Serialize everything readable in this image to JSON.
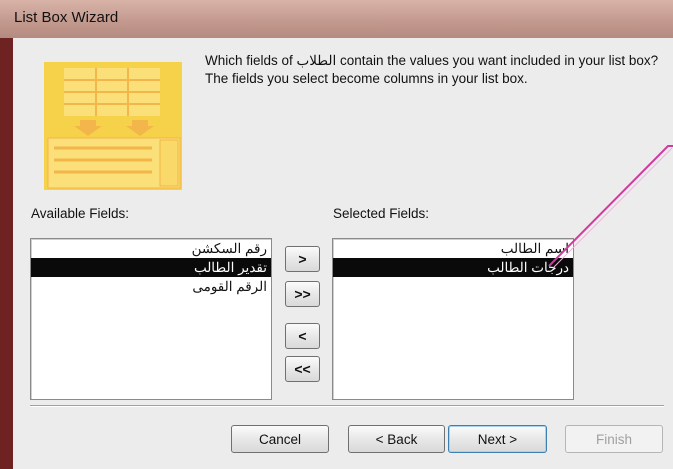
{
  "window": {
    "title": "List Box Wizard"
  },
  "instruction": "Which fields of الطلاب contain the values you want included in your list box? The fields you select become columns in your list box.",
  "available": {
    "label": "Available Fields:",
    "items": [
      {
        "text": "رقم السكشن",
        "selected": false
      },
      {
        "text": "تقدير الطالب",
        "selected": true
      },
      {
        "text": "الرقم القومى",
        "selected": false
      }
    ]
  },
  "selected": {
    "label": "Selected Fields:",
    "items": [
      {
        "text": "اسم الطالب",
        "selected": false
      },
      {
        "text": "درجات الطالب",
        "selected": true
      }
    ]
  },
  "transfer": {
    "add_one": ">",
    "add_all": ">>",
    "remove_one": "<",
    "remove_all": "<<"
  },
  "footer": {
    "cancel": "Cancel",
    "back": "< Back",
    "next": "Next >",
    "finish": "Finish"
  },
  "colors": {
    "selection": "#0a0a0a",
    "wizard_image": "#f6d24a",
    "annotation_line": "#d23aa0"
  }
}
